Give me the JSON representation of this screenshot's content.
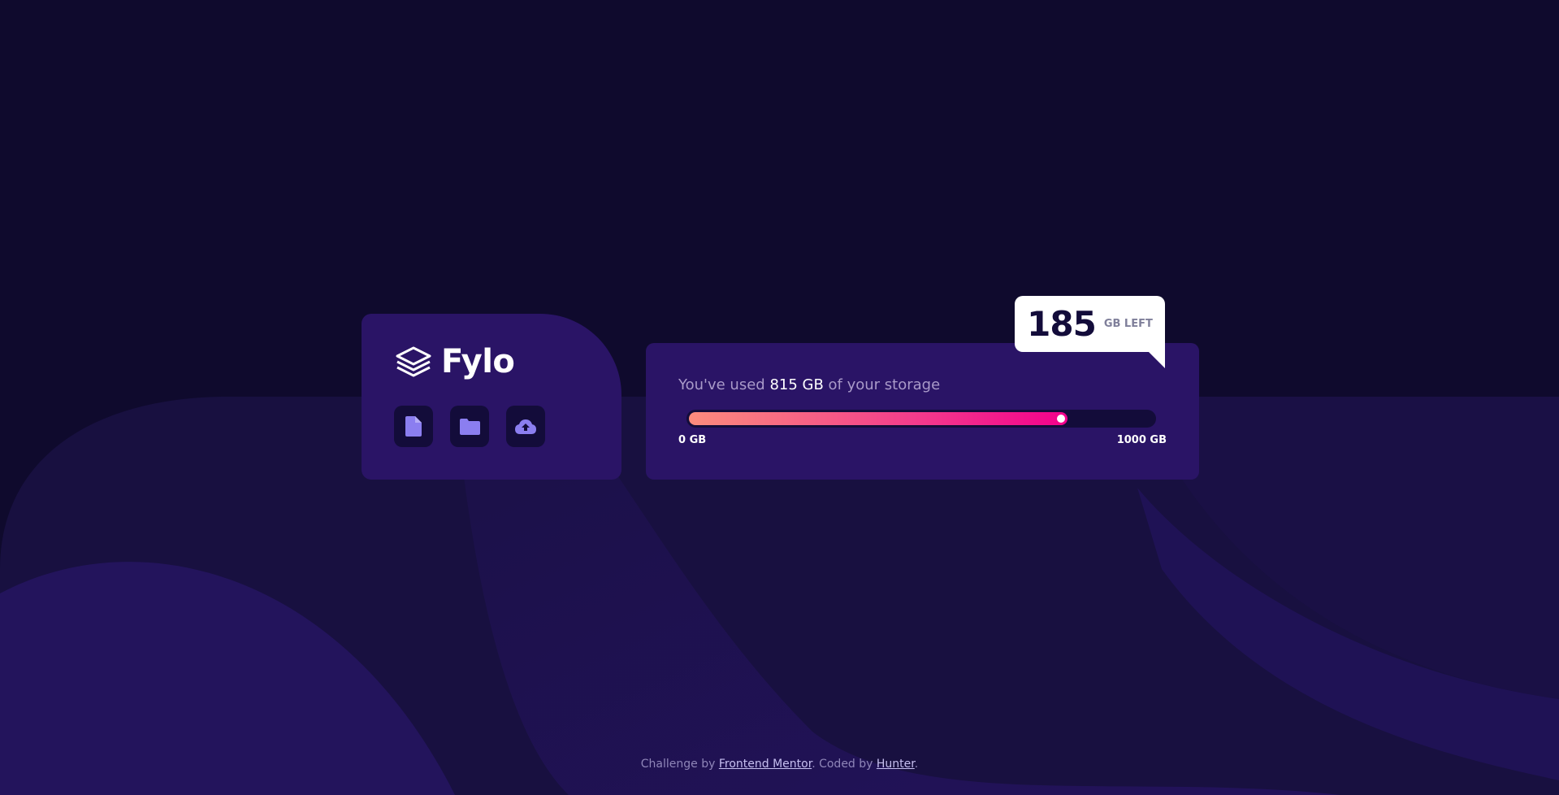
{
  "colors": {
    "background": "#0f0a2d",
    "card": "#2a1466",
    "tile": "#130c3a",
    "gradient_start": "#fb8c7d",
    "gradient_end": "#f2008c",
    "icon": "#8b7ef0"
  },
  "brand": {
    "name": "Fylo",
    "logo_icon": "layers-icon"
  },
  "tools": [
    {
      "icon": "document-icon"
    },
    {
      "icon": "folder-icon"
    },
    {
      "icon": "cloud-upload-icon"
    }
  ],
  "storage": {
    "used_prefix": "You've used ",
    "used_amount": "815 GB",
    "used_suffix": " of your storage",
    "min_label": "0 GB",
    "max_label": "1000 GB",
    "used_fraction": 0.815
  },
  "tooltip": {
    "remaining": "185",
    "unit": "GB LEFT"
  },
  "footer": {
    "prefix": "Challenge by ",
    "challenge_link": "Frontend Mentor",
    "middle": ". Coded by ",
    "author_link": "Hunter",
    "suffix": "."
  }
}
